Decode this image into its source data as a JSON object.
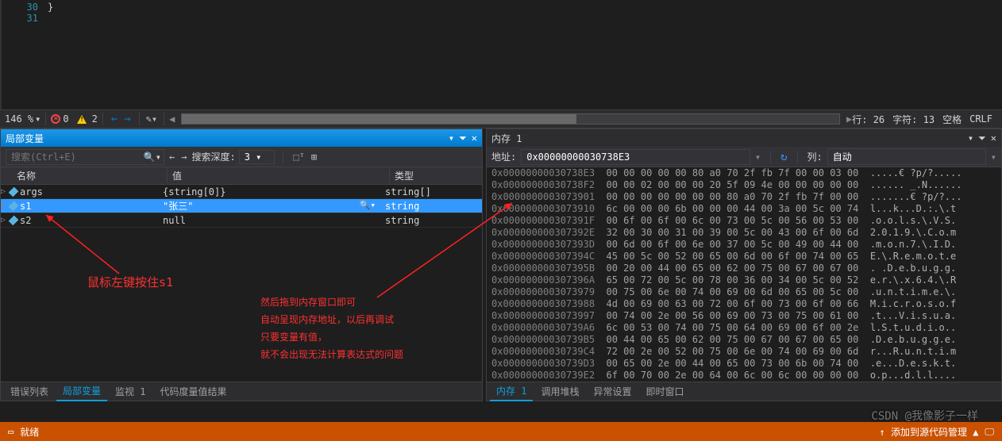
{
  "editor": {
    "lines": [
      {
        "num": "30",
        "code": "}"
      },
      {
        "num": "31",
        "code": ""
      }
    ]
  },
  "statusbar": {
    "zoom": "146 %",
    "errors": "0",
    "warnings": "2",
    "right": {
      "line_label": "行:",
      "line_val": "26",
      "char_label": "字符:",
      "char_val": "13",
      "spaces": "空格",
      "eol": "CRLF"
    }
  },
  "locals_panel": {
    "title": "局部变量",
    "search_placeholder": "搜索(Ctrl+E)",
    "depth_label": "搜索深度:",
    "depth_value": "3",
    "columns": {
      "name": "名称",
      "value": "值",
      "type": "类型"
    },
    "rows": [
      {
        "name": "args",
        "value": "{string[0]}",
        "type": "string[]",
        "selected": false
      },
      {
        "name": "s1",
        "value": "\"张三\"",
        "type": "string",
        "selected": true,
        "magnify": true
      },
      {
        "name": "s2",
        "value": "null",
        "type": "string",
        "selected": false
      }
    ],
    "tabs": [
      "错误列表",
      "局部变量",
      "监视 1",
      "代码度量值结果"
    ],
    "active_tab": 1
  },
  "memory_panel": {
    "title": "内存 1",
    "addr_label": "地址:",
    "addr_value": "0x00000000030738E3",
    "col_label": "列:",
    "col_value": "自动",
    "rows": [
      {
        "a": "0x00000000030738E3",
        "h": "00 00 00 00 00 80 a0 70 2f fb 7f 00 00 03 00",
        "t": ".....€ ?p/?....."
      },
      {
        "a": "0x00000000030738F2",
        "h": "00 00 02 00 00 00 20 5f 09 4e 00 00 00 00 00",
        "t": "...... _.N......"
      },
      {
        "a": "0x0000000003073901",
        "h": "00 00 00 00 00 00 00 80 a0 70 2f fb 7f 00 00",
        "t": ".......€ ?p/?..."
      },
      {
        "a": "0x0000000003073910",
        "h": "6c 00 00 00 6b 00 00 00 44 00 3a 00 5c 00 74",
        "t": "l...k...D.:.\\.t"
      },
      {
        "a": "0x000000000307391F",
        "h": "00 6f 00 6f 00 6c 00 73 00 5c 00 56 00 53 00",
        "t": ".o.o.l.s.\\.V.S."
      },
      {
        "a": "0x000000000307392E",
        "h": "32 00 30 00 31 00 39 00 5c 00 43 00 6f 00 6d",
        "t": "2.0.1.9.\\.C.o.m"
      },
      {
        "a": "0x000000000307393D",
        "h": "00 6d 00 6f 00 6e 00 37 00 5c 00 49 00 44 00",
        "t": ".m.o.n.7.\\.I.D."
      },
      {
        "a": "0x000000000307394C",
        "h": "45 00 5c 00 52 00 65 00 6d 00 6f 00 74 00 65",
        "t": "E.\\.R.e.m.o.t.e"
      },
      {
        "a": "0x000000000307395B",
        "h": "00 20 00 44 00 65 00 62 00 75 00 67 00 67 00",
        "t": ". .D.e.b.u.g.g."
      },
      {
        "a": "0x000000000307396A",
        "h": "65 00 72 00 5c 00 78 00 36 00 34 00 5c 00 52",
        "t": "e.r.\\.x.6.4.\\.R"
      },
      {
        "a": "0x0000000003073979",
        "h": "00 75 00 6e 00 74 00 69 00 6d 00 65 00 5c 00",
        "t": ".u.n.t.i.m.e.\\."
      },
      {
        "a": "0x0000000003073988",
        "h": "4d 00 69 00 63 00 72 00 6f 00 73 00 6f 00 66",
        "t": "M.i.c.r.o.s.o.f"
      },
      {
        "a": "0x0000000003073997",
        "h": "00 74 00 2e 00 56 00 69 00 73 00 75 00 61 00",
        "t": ".t...V.i.s.u.a."
      },
      {
        "a": "0x00000000030739A6",
        "h": "6c 00 53 00 74 00 75 00 64 00 69 00 6f 00 2e",
        "t": "l.S.t.u.d.i.o.."
      },
      {
        "a": "0x00000000030739B5",
        "h": "00 44 00 65 00 62 00 75 00 67 00 67 00 65 00",
        "t": ".D.e.b.u.g.g.e."
      },
      {
        "a": "0x00000000030739C4",
        "h": "72 00 2e 00 52 00 75 00 6e 00 74 00 69 00 6d",
        "t": "r...R.u.n.t.i.m"
      },
      {
        "a": "0x00000000030739D3",
        "h": "00 65 00 2e 00 44 00 65 00 73 00 6b 00 74 00",
        "t": ".e...D.e.s.k.t."
      },
      {
        "a": "0x00000000030739E2",
        "h": "6f 00 70 00 2e 00 64 00 6c 00 6c 00 00 00 00",
        "t": "o.p...d.l.l...."
      }
    ],
    "tabs": [
      "内存 1",
      "调用堆栈",
      "异常设置",
      "即时窗口"
    ],
    "active_tab": 0
  },
  "bottom": {
    "status": "就绪",
    "add_to_source": "↑ 添加到源代码管理 ▲"
  },
  "annotations": {
    "left": "鼠标左键按住s1",
    "right_l1": "然后拖到内存窗口即可",
    "right_l2": "自动呈现内存地址，以后再调试",
    "right_l3": "只要变量有值，",
    "right_l4": "就不会出现无法计算表达式的问题"
  },
  "watermark": "CSDN @我像影子一样"
}
